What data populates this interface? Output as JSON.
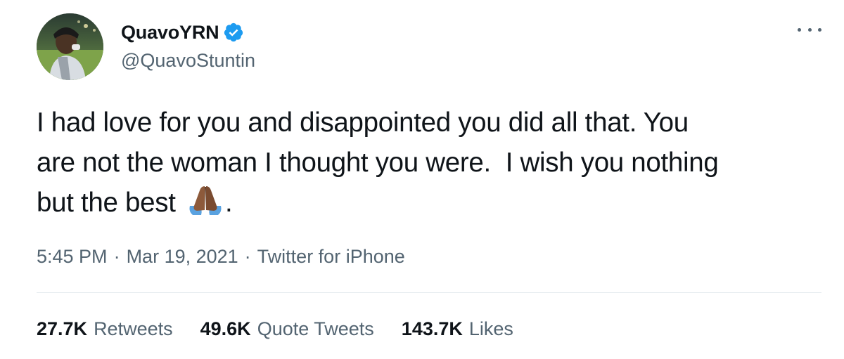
{
  "tweet": {
    "author": {
      "display_name": "QuavoYRN",
      "handle": "@QuavoStuntin",
      "verified": true
    },
    "text_line1": "I had love for you and disappointed you did all that. You",
    "text_line2": "are not the woman I thought you were.  I wish you nothing",
    "text_line3_before": "but the best ",
    "text_line3_after": ".",
    "emoji": "folded-hands-medium-dark-skin-tone",
    "time": "5:45 PM",
    "date": "Mar 19, 2021",
    "source": "Twitter for iPhone",
    "separator": "·"
  },
  "stats": [
    {
      "count": "27.7K",
      "label": "Retweets"
    },
    {
      "count": "49.6K",
      "label": "Quote Tweets"
    },
    {
      "count": "143.7K",
      "label": "Likes"
    }
  ],
  "colors": {
    "text": "#0f1419",
    "secondary": "#536471",
    "verified_badge": "#1d9bf0",
    "divider": "#e6ecf0"
  },
  "icons": {
    "verified": "verified-badge-icon",
    "more": "more-options-icon"
  }
}
